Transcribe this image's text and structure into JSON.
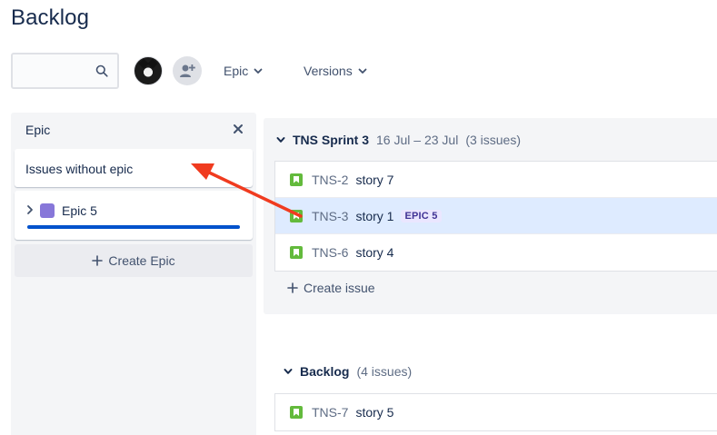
{
  "page": {
    "title": "Backlog"
  },
  "toolbar": {
    "search": {
      "value": "",
      "placeholder": ""
    },
    "filters": {
      "epic_label": "Epic",
      "versions_label": "Versions"
    }
  },
  "epic_panel": {
    "title": "Epic",
    "issues_without_epic": "Issues without epic",
    "epics": [
      {
        "name": "Epic 5",
        "color": "#8777d9",
        "progress": 1.0
      }
    ],
    "create_epic_label": "Create Epic"
  },
  "sprint": {
    "name": "TNS Sprint 3",
    "dates": "16 Jul – 23 Jul",
    "count": "(3 issues)",
    "issues": [
      {
        "key": "TNS-2",
        "summary": "story 7",
        "epic": ""
      },
      {
        "key": "TNS-3",
        "summary": "story 1",
        "epic": "EPIC 5"
      },
      {
        "key": "TNS-6",
        "summary": "story 4",
        "epic": ""
      }
    ],
    "create_issue_label": "Create issue"
  },
  "backlog": {
    "name": "Backlog",
    "count": "(4 issues)",
    "issues": [
      {
        "key": "TNS-7",
        "summary": "story 5"
      }
    ]
  },
  "colors": {
    "story": "#63ba3c",
    "selected_row": "#deebff",
    "annotation_arrow": "#f03b1f",
    "epic_progress": "#0052cc"
  }
}
